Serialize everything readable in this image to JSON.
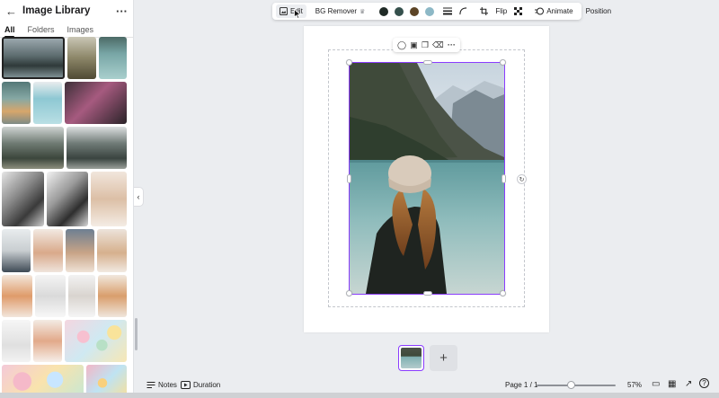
{
  "panel": {
    "title": "Image Library",
    "tabs": [
      "All",
      "Folders",
      "Images"
    ],
    "active_tab": "All"
  },
  "toolbar": {
    "edit_label": "Edit",
    "bg_remover_label": "BG Remover",
    "colors": [
      "#1f2a26",
      "#35504c",
      "#5c4426",
      "#8db8c6"
    ],
    "flip_label": "Flip",
    "animate_label": "Animate",
    "position_label": "Position"
  },
  "canvas": {
    "selected_image": "lake-woman-beanie-photo"
  },
  "footer": {
    "notes_label": "Notes",
    "duration_label": "Duration",
    "page_indicator": "Page 1 / 1",
    "zoom_level": "57%",
    "zoom_fraction": 0.44
  },
  "accent_color": "#8b3dff",
  "icons": {
    "back": "arrow-left-icon",
    "more": "more-horizontal-icon",
    "collapse": "chevron-left-icon",
    "edit": "image-edit-icon",
    "crown": "crown-icon",
    "lines": "line-weight-icon",
    "curve": "corner-radius-icon",
    "crop": "crop-icon",
    "transparency": "transparency-icon",
    "animate": "animate-icon",
    "notes": "notes-icon",
    "duration": "play-icon"
  }
}
